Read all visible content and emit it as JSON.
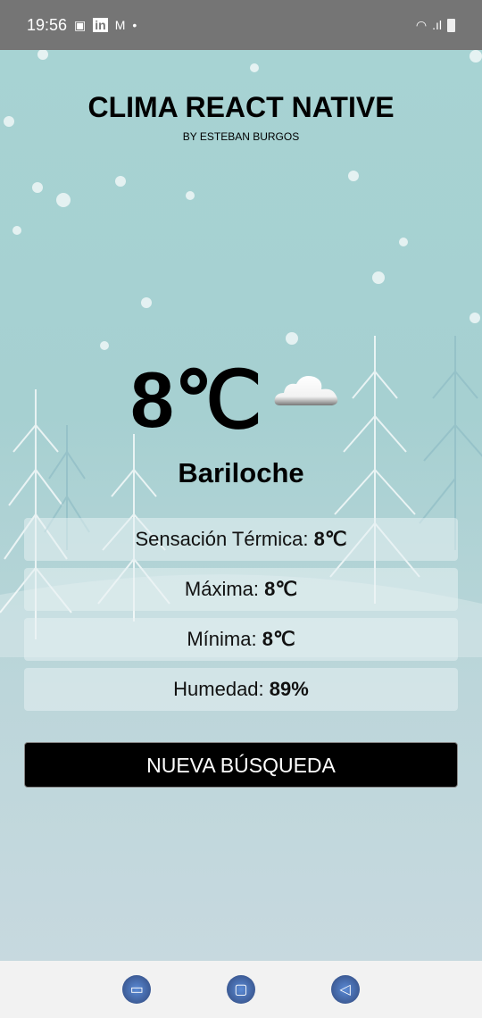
{
  "status_bar": {
    "time": "19:56",
    "icons": [
      "gallery-icon",
      "linkedin-icon",
      "gmail-icon",
      "dot-icon",
      "wifi-icon",
      "signal-icon",
      "battery-icon"
    ]
  },
  "header": {
    "title": "CLIMA REACT NATIVE",
    "subtitle": "BY ESTEBAN BURGOS"
  },
  "weather": {
    "temperature": "8℃",
    "icon": "cloud-icon",
    "city": "Bariloche",
    "details": [
      {
        "label": "Sensación Térmica: ",
        "value": "8℃"
      },
      {
        "label": "Máxima: ",
        "value": "8℃"
      },
      {
        "label": "Mínima: ",
        "value": "8℃"
      },
      {
        "label": "Humedad: ",
        "value": "89%"
      }
    ]
  },
  "button": {
    "label": "NUEVA BÚSQUEDA"
  },
  "nav": {
    "items": [
      "recents-icon",
      "home-icon",
      "back-icon"
    ]
  },
  "colors": {
    "bg_top": "#a7d3d3",
    "bg_bottom": "#c7d9df",
    "button": "#000000"
  }
}
